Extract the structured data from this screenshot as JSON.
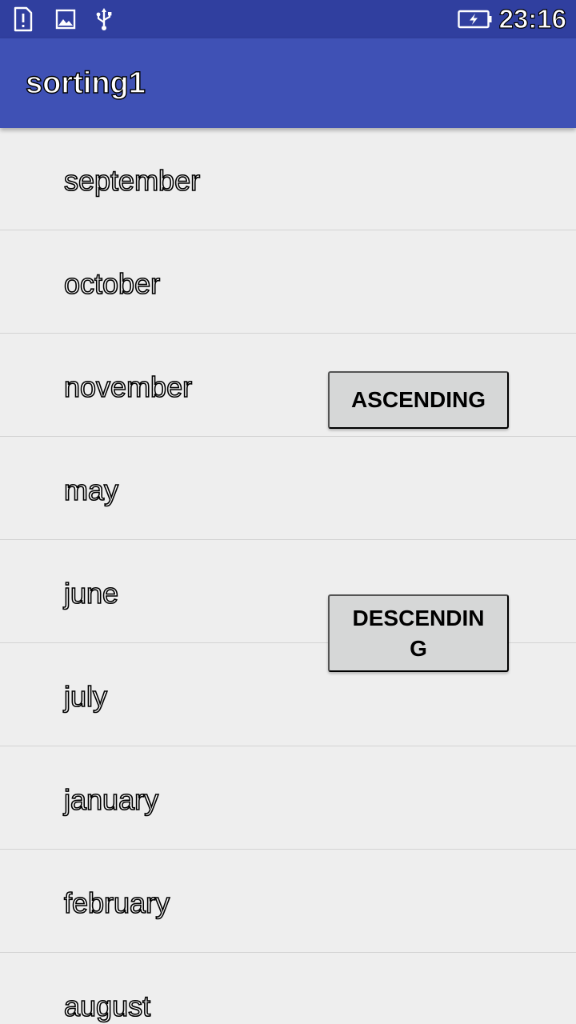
{
  "status_bar": {
    "time": "23:16",
    "icons": [
      "sim-alert-icon",
      "image-icon",
      "usb-icon",
      "battery-charging-icon"
    ]
  },
  "app_bar": {
    "title": "sorting1"
  },
  "months": [
    {
      "label": "september"
    },
    {
      "label": "october"
    },
    {
      "label": "november"
    },
    {
      "label": "may"
    },
    {
      "label": "june"
    },
    {
      "label": "july"
    },
    {
      "label": "january"
    },
    {
      "label": "february"
    },
    {
      "label": "august"
    }
  ],
  "buttons": {
    "ascending_label": "ASCENDING",
    "descending_label": "DESCENDING"
  },
  "colors": {
    "status_bar": "#303f9f",
    "app_bar": "#3f51b5",
    "background": "#eeeeee",
    "button": "#d6d7d7"
  }
}
